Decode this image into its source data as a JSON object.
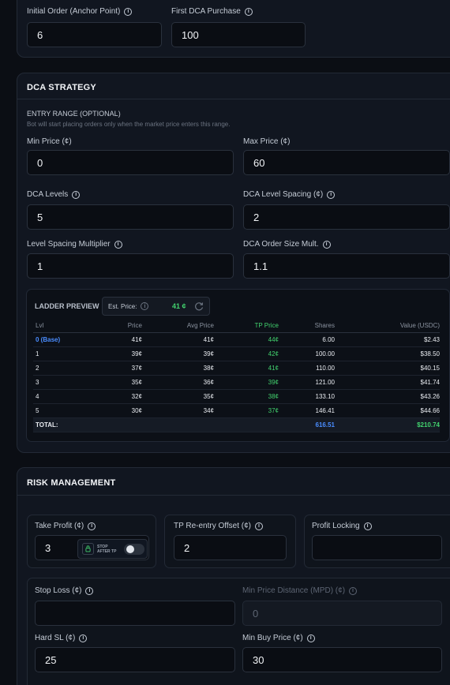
{
  "top": {
    "initial_order_label": "Initial Order (Anchor Point)",
    "initial_order_value": "6",
    "first_dca_label": "First DCA Purchase",
    "first_dca_value": "100"
  },
  "dca": {
    "title": "DCA STRATEGY",
    "entry_range_label": "ENTRY RANGE (OPTIONAL)",
    "entry_range_hint": "Bot will start placing orders only when the market price enters this range.",
    "min_price_label": "Min Price (¢)",
    "min_price_value": "0",
    "max_price_label": "Max Price (¢)",
    "max_price_value": "60",
    "levels_label": "DCA Levels",
    "levels_value": "5",
    "spacing_label": "DCA Level Spacing (¢)",
    "spacing_value": "2",
    "multiplier_label": "Level Spacing Multiplier",
    "multiplier_value": "1",
    "order_size_label": "DCA Order Size Mult.",
    "order_size_value": "1.1"
  },
  "ladder": {
    "title": "LADDER PREVIEW",
    "est_price_label": "Est. Price:",
    "est_price_value": "41 ¢",
    "headers": [
      "Lvl",
      "Price",
      "Avg Price",
      "TP Price",
      "Shares",
      "Value (USDC)"
    ],
    "rows": [
      [
        "0 (Base)",
        "41¢",
        "41¢",
        "44¢",
        "6.00",
        "$2.43"
      ],
      [
        "1",
        "39¢",
        "39¢",
        "42¢",
        "100.00",
        "$38.50"
      ],
      [
        "2",
        "37¢",
        "38¢",
        "41¢",
        "110.00",
        "$40.15"
      ],
      [
        "3",
        "35¢",
        "36¢",
        "39¢",
        "121.00",
        "$41.74"
      ],
      [
        "4",
        "32¢",
        "35¢",
        "38¢",
        "133.10",
        "$43.26"
      ],
      [
        "5",
        "30¢",
        "34¢",
        "37¢",
        "146.41",
        "$44.66"
      ]
    ],
    "total_label": "TOTAL:",
    "total_shares": "616.51",
    "total_value": "$210.74"
  },
  "risk": {
    "title": "RISK MANAGEMENT",
    "take_profit_label": "Take Profit (¢)",
    "take_profit_value": "3",
    "stop_after_tp": "STOP AFTER TP",
    "tp_reentry_label": "TP Re-entry Offset (¢)",
    "tp_reentry_value": "2",
    "profit_locking_label": "Profit Locking",
    "profit_locking_value": "",
    "stop_loss_label": "Stop Loss (¢)",
    "stop_loss_value": "",
    "mpd_label": "Min Price Distance (MPD) (¢)",
    "mpd_value": "0",
    "hard_sl_label": "Hard SL (¢)",
    "hard_sl_value": "25",
    "min_buy_label": "Min Buy Price (¢)",
    "min_buy_value": "30"
  },
  "colors": {
    "accent_green": "#42d26e",
    "accent_blue": "#4a8dff"
  }
}
